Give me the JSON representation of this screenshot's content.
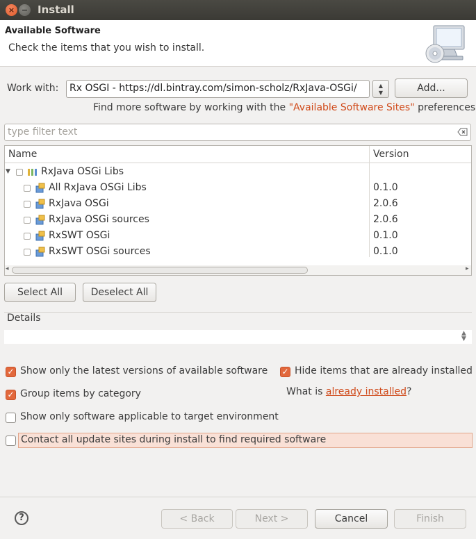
{
  "window": {
    "title": "Install",
    "close_glyph": "×",
    "minimize_glyph": "−"
  },
  "header": {
    "title": "Available Software",
    "subtitle": "Check the items that you wish to install.",
    "icon": "install-computer-cd-icon"
  },
  "work_with": {
    "label": "Work with:",
    "value": "Rx OSGI - https://dl.bintray.com/simon-scholz/RxJava-OSGi/",
    "add_label": "Add...",
    "more_prefix": "Find more software by working with the ",
    "more_link": "\"Available Software Sites\"",
    "more_suffix": " preferences."
  },
  "filter": {
    "placeholder": "type filter text"
  },
  "tree": {
    "columns": [
      "Name",
      "Version"
    ],
    "category": {
      "label": "RxJava OSGi Libs"
    },
    "items": [
      {
        "name": "All RxJava OSGi Libs",
        "version": "0.1.0"
      },
      {
        "name": "RxJava OSGi",
        "version": "2.0.6"
      },
      {
        "name": "RxJava OSGi sources",
        "version": "2.0.6"
      },
      {
        "name": "RxSWT OSGi",
        "version": "0.1.0"
      },
      {
        "name": "RxSWT OSGi sources",
        "version": "0.1.0"
      }
    ]
  },
  "buttons": {
    "select_all": "Select All",
    "deselect_all": "Deselect All"
  },
  "details": {
    "label": "Details"
  },
  "options": {
    "latest_versions": {
      "label": "Show only the latest versions of available software",
      "checked": true
    },
    "hide_installed": {
      "label": "Hide items that are already installed",
      "checked": true
    },
    "group_by_category": {
      "label": "Group items by category",
      "checked": true
    },
    "what_is_prefix": "What is ",
    "what_is_link": "already installed",
    "what_is_suffix": "?",
    "target_env": {
      "label": "Show only software applicable to target environment",
      "checked": false
    },
    "contact_all": {
      "label": "Contact all update sites during install to find required software",
      "checked": false
    }
  },
  "footer": {
    "back": "< Back",
    "next": "Next >",
    "cancel": "Cancel",
    "finish": "Finish",
    "help": "?"
  },
  "colors": {
    "accent": "#e2683c",
    "link": "#d04a1a",
    "highlight": "#f9e0d6"
  }
}
